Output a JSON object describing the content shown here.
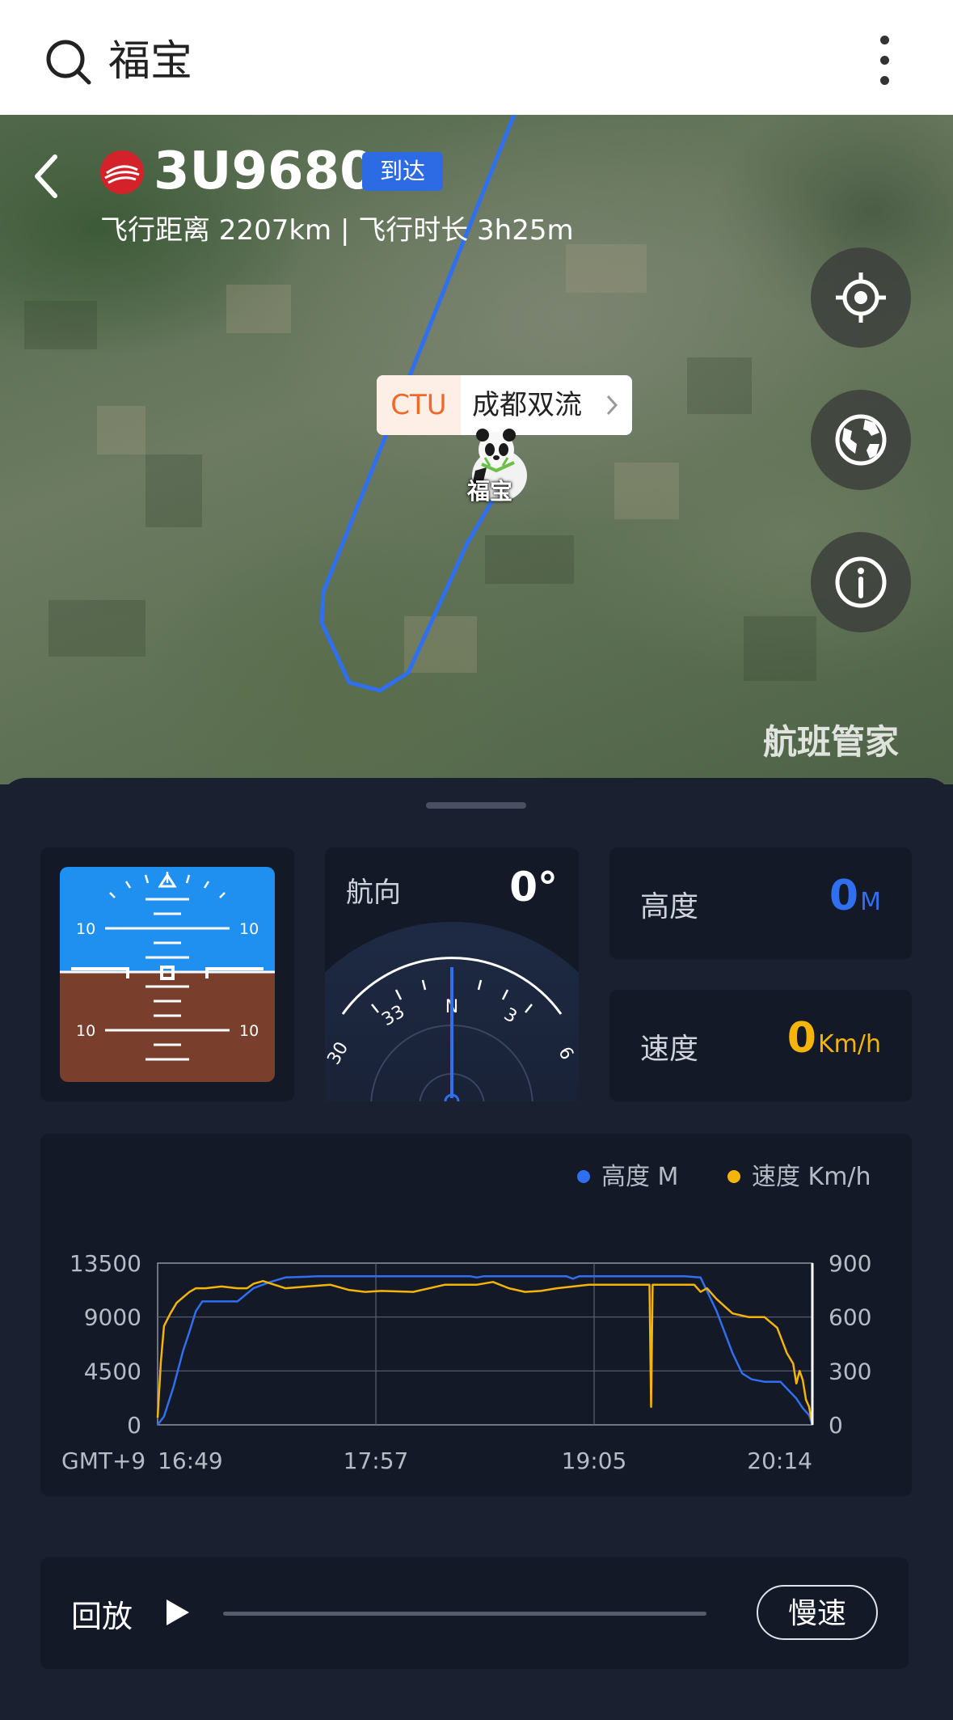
{
  "search": {
    "query": "福宝"
  },
  "flight": {
    "number": "3U9680",
    "status": "到达",
    "meta": "飞行距离  2207km | 飞行时长 3h25m"
  },
  "map": {
    "airport_code": "CTU",
    "airport_name": "成都双流",
    "marker_label": "福宝",
    "watermark": "航班管家",
    "buttons": [
      "locate-icon",
      "globe-icon",
      "info-icon"
    ]
  },
  "instruments": {
    "attitude": {
      "pitch_marks": [
        "10",
        "10",
        "10",
        "10"
      ]
    },
    "heading": {
      "label": "航向",
      "value": "0°",
      "dial_labels": [
        "30",
        "33",
        "N",
        "3",
        "6"
      ]
    },
    "altitude": {
      "label": "高度",
      "value": "0",
      "unit": "M",
      "color": "#2f6ff0"
    },
    "speed": {
      "label": "速度",
      "value": "0",
      "unit": "Km/h",
      "color": "#f5b40a"
    }
  },
  "chart_data": {
    "type": "line",
    "legend_position": "top-right",
    "timezone_label": "GMT+9",
    "x_ticks": [
      "16:49",
      "17:57",
      "19:05",
      "20:14"
    ],
    "y_left_ticks": [
      "13500",
      "9000",
      "4500",
      "0"
    ],
    "y_right_ticks": [
      "900",
      "600",
      "300",
      "0"
    ],
    "y_left_range": [
      0,
      13500
    ],
    "y_right_range": [
      0,
      900
    ],
    "x_range_minutes": [
      0,
      205
    ],
    "grid": true,
    "series": [
      {
        "name": "高度 M",
        "axis": "left",
        "color": "#2f6ff0",
        "x_minutes": [
          0,
          2,
          5,
          8,
          10,
          12,
          14,
          17,
          20,
          25,
          30,
          32,
          35,
          40,
          50,
          60,
          70,
          80,
          90,
          98,
          100,
          102,
          105,
          110,
          120,
          128,
          130,
          132,
          140,
          150,
          160,
          162,
          165,
          170,
          175,
          180,
          183,
          186,
          190,
          195,
          200,
          202,
          204,
          205
        ],
        "values": [
          0,
          700,
          3200,
          6200,
          7800,
          9500,
          10300,
          10300,
          10300,
          10300,
          11400,
          11600,
          11900,
          12300,
          12400,
          12400,
          12400,
          12400,
          12400,
          12400,
          12300,
          12400,
          12400,
          12400,
          12400,
          12400,
          12200,
          12400,
          12400,
          12400,
          12400,
          12400,
          12400,
          12300,
          9500,
          6000,
          4300,
          3800,
          3600,
          3600,
          2200,
          1400,
          800,
          0
        ]
      },
      {
        "name": "速度 Km/h",
        "axis": "right",
        "color": "#f5b40a",
        "x_minutes": [
          0,
          1,
          2,
          4,
          6,
          8,
          10,
          12,
          15,
          20,
          25,
          28,
          30,
          33,
          40,
          47,
          54,
          60,
          65,
          70,
          80,
          90,
          100,
          105,
          110,
          115,
          120,
          125,
          135,
          140,
          150,
          154,
          154.5,
          155,
          160,
          168,
          170,
          172,
          175,
          180,
          185,
          190,
          194,
          197,
          199,
          200,
          201,
          202,
          203,
          204,
          205
        ],
        "values": [
          40,
          350,
          550,
          620,
          680,
          710,
          740,
          760,
          760,
          770,
          760,
          760,
          785,
          800,
          760,
          770,
          780,
          750,
          740,
          745,
          740,
          780,
          780,
          795,
          760,
          740,
          745,
          760,
          780,
          780,
          780,
          780,
          100,
          780,
          780,
          780,
          740,
          760,
          700,
          620,
          600,
          600,
          540,
          400,
          340,
          230,
          300,
          250,
          140,
          100,
          0
        ]
      }
    ]
  },
  "playback": {
    "label": "回放",
    "speed_label": "慢速",
    "progress": 0
  }
}
